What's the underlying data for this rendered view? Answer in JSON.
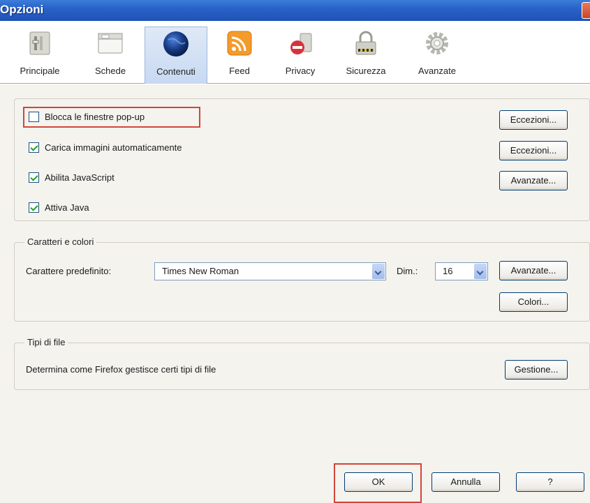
{
  "window": {
    "title": "Opzioni"
  },
  "tabs": [
    {
      "label": "Principale",
      "icon": "switch-icon"
    },
    {
      "label": "Schede",
      "icon": "tabs-icon"
    },
    {
      "label": "Contenuti",
      "icon": "globe-icon"
    },
    {
      "label": "Feed",
      "icon": "rss-icon"
    },
    {
      "label": "Privacy",
      "icon": "mask-icon"
    },
    {
      "label": "Sicurezza",
      "icon": "padlock-icon"
    },
    {
      "label": "Avanzate",
      "icon": "gear-icon"
    }
  ],
  "active_tab": "Contenuti",
  "content": {
    "options": [
      {
        "label": "Blocca le finestre pop-up",
        "checked": false,
        "button": "Eccezioni..."
      },
      {
        "label": "Carica immagini automaticamente",
        "checked": true,
        "button": "Eccezioni..."
      },
      {
        "label": "Abilita JavaScript",
        "checked": true,
        "button": "Avanzate..."
      },
      {
        "label": "Attiva Java",
        "checked": true
      }
    ]
  },
  "fonts": {
    "legend": "Caratteri e colori",
    "default_label": "Carattere predefinito:",
    "default_value": "Times New Roman",
    "size_label": "Dim.:",
    "size_value": "16",
    "advanced_button": "Avanzate...",
    "colors_button": "Colori..."
  },
  "filetypes": {
    "legend": "Tipi di file",
    "description": "Determina come Firefox gestisce certi tipi di file",
    "manage_button": "Gestione..."
  },
  "footer": {
    "ok": "OK",
    "cancel": "Annulla",
    "help": "?"
  },
  "colors": {
    "highlight": "#d2453b",
    "titlebar": "#2a62c9",
    "panel": "#f4f3ee"
  }
}
